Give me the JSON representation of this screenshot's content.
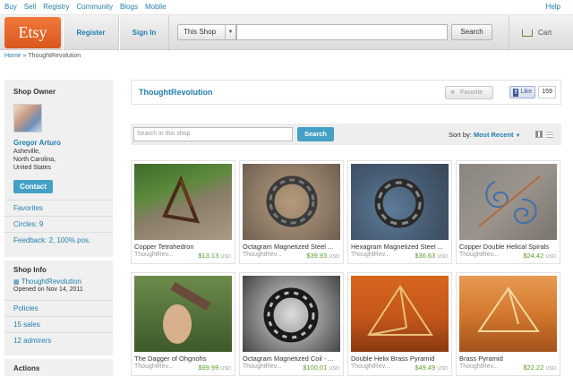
{
  "topnav": {
    "links": [
      "Buy",
      "Sell",
      "Registry",
      "Community",
      "Blogs",
      "Mobile"
    ],
    "help": "Help"
  },
  "header": {
    "logo": "Etsy",
    "register": "Register",
    "sign_in": "Sign In",
    "scope": "This Shop",
    "search_value": "",
    "search_button": "Search",
    "cart": "Cart"
  },
  "breadcrumb": {
    "home": "Home",
    "sep": " » ",
    "current": "ThoughtRevolution"
  },
  "sidebar": {
    "owner_title": "Shop Owner",
    "owner_name": "Gregor Arturo",
    "location": [
      "Asheville,",
      "North Carolina,",
      "United States"
    ],
    "contact": "Contact",
    "favorites": "Favorites",
    "circles": "Circles: 9",
    "feedback": "Feedback: 2, 100% pos.",
    "info_title": "Shop Info",
    "shop_name": "ThoughtRevolution",
    "opened": "Opened on Nov 14, 2011",
    "policies": "Policies",
    "sales": "15 sales",
    "admirers": "12 admirers",
    "actions_title": "Actions"
  },
  "shopbar": {
    "name": "ThoughtRevolution",
    "favorite": "Favorite",
    "like": "Like",
    "like_count": "159"
  },
  "filter": {
    "placeholder": "Search in this shop",
    "search": "Search",
    "sort_label": "Sort by:",
    "sort_value": "Most Recent"
  },
  "currency": "USD",
  "listings": [
    {
      "title": "Copper Tetrahedron",
      "shop": "ThoughtRev...",
      "price": "$13.13"
    },
    {
      "title": "Octagram Magnetized Steel ...",
      "shop": "ThoughtRev...",
      "price": "$39.93"
    },
    {
      "title": "Hexagram Magnetized Steel ...",
      "shop": "ThoughtRev...",
      "price": "$36.63"
    },
    {
      "title": "Copper Double Helical Spirals",
      "shop": "ThoughtRev...",
      "price": "$24.42"
    },
    {
      "title": "The Dagger of Ohgnohs",
      "shop": "ThoughtRev...",
      "price": "$99.99"
    },
    {
      "title": "Octagram Magnetized Coil - ...",
      "shop": "ThoughtRev...",
      "price": "$100.01"
    },
    {
      "title": "Double Helix Brass Pyramid",
      "shop": "ThoughtRev...",
      "price": "$49.49"
    },
    {
      "title": "Brass Pyramid",
      "shop": "ThoughtRev...",
      "price": "$22.22"
    }
  ]
}
